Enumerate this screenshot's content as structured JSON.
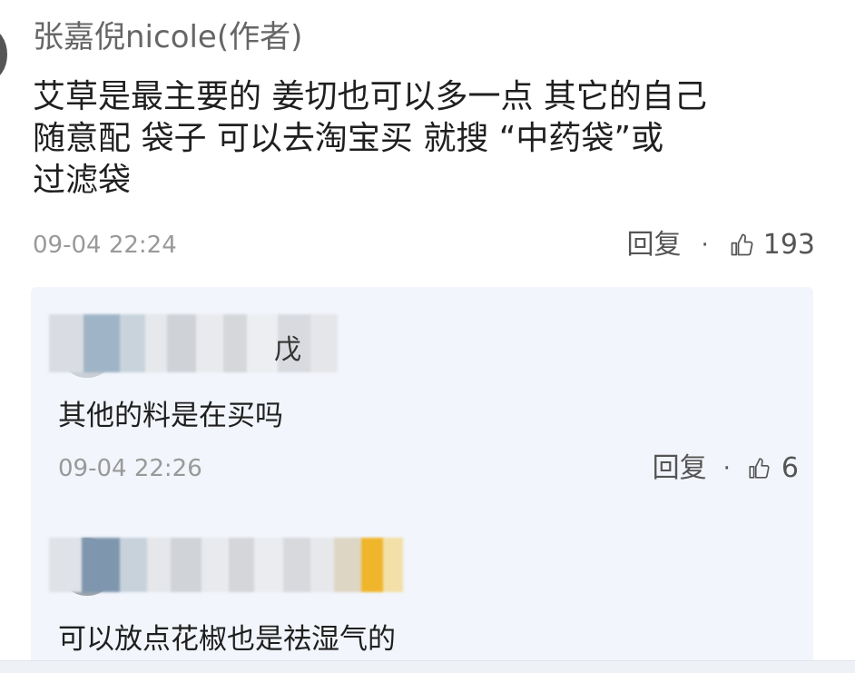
{
  "comment": {
    "author": "张嘉倪nicole(作者)",
    "body_lines": [
      "艾草是最主要的 姜切也可以多一点 其它的自己",
      "随意配 袋子 可以去淘宝买 就搜 “中药袋”或",
      "过滤袋"
    ],
    "timestamp": "09-04 22:24",
    "reply_label": "回复",
    "separator": "·",
    "like_count": "193"
  },
  "replies": [
    {
      "name_suffix": "戊",
      "text": "其他的料是在买吗",
      "timestamp": "09-04 22:26",
      "reply_label": "回复",
      "separator": "·",
      "like_count": "6"
    },
    {
      "text": "可以放点花椒也是祛湿气的"
    }
  ],
  "colors": {
    "panel_bg": "#f2f5fb",
    "meta_text": "#999999",
    "action_text": "#555555"
  }
}
